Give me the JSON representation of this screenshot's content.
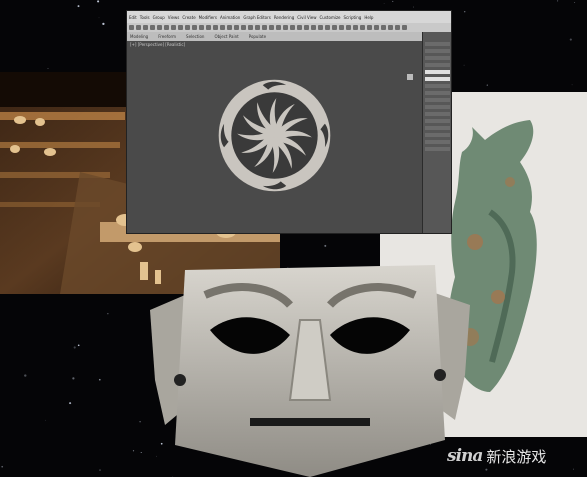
{
  "software": {
    "menu": [
      "Edit",
      "Tools",
      "Group",
      "Views",
      "Create",
      "Modifiers",
      "Animation",
      "Graph Editors",
      "Rendering",
      "Civil View",
      "Customize",
      "Scripting",
      "Help"
    ],
    "tabs": [
      "Modeling",
      "Freeform",
      "Selection",
      "Object Paint",
      "Populate"
    ],
    "viewport_label": "[+] [Perspective] [Realistic]"
  },
  "watermark": {
    "logo": "sina",
    "text": "新浪游戏"
  },
  "colors": {
    "relief": "#c9c5bf",
    "relief_shadow": "#3a3a3a",
    "bronze_green": "#6f8a74",
    "bronze_rust": "#a9744a",
    "mask_stone": "#b9b6ae"
  }
}
